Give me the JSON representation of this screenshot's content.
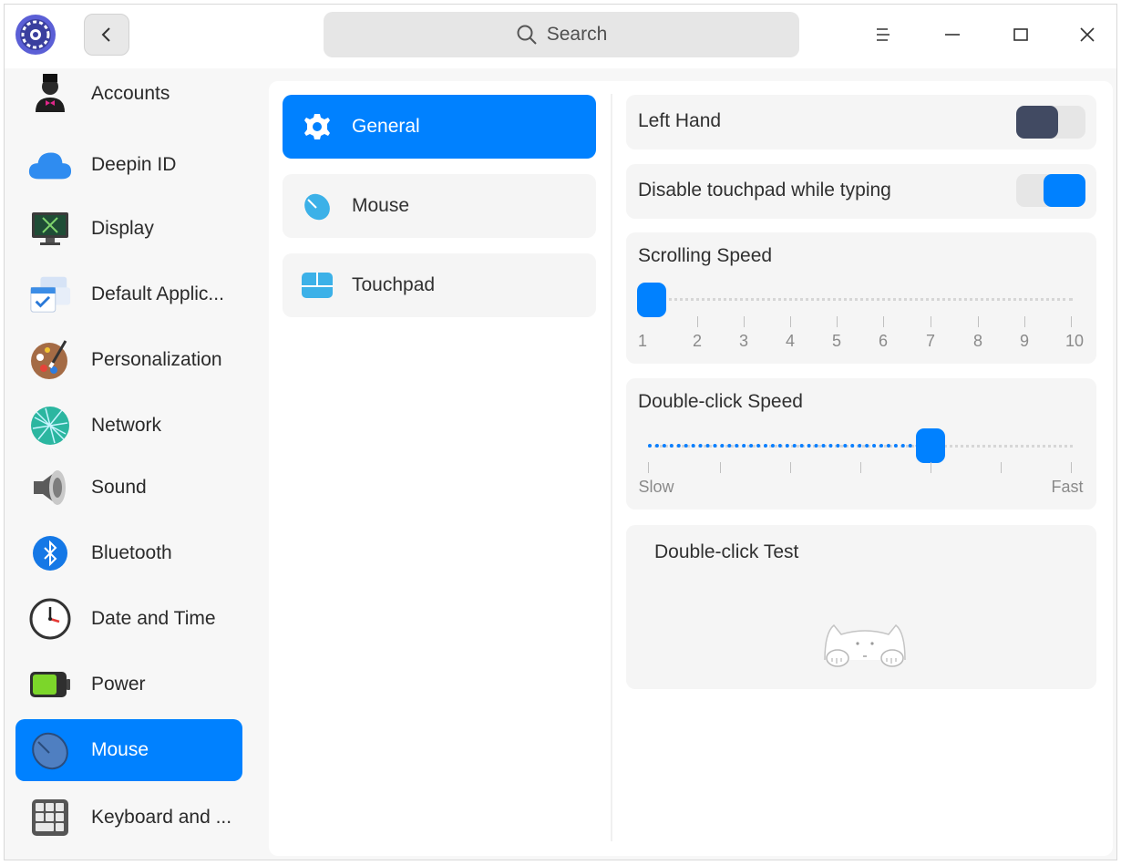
{
  "titlebar": {
    "search_placeholder": "Search",
    "icons": [
      "app-settings-icon",
      "back-arrow-icon",
      "search-icon",
      "menu-icon",
      "minimize-icon",
      "maximize-icon",
      "close-icon"
    ]
  },
  "sidebar": {
    "items": [
      {
        "label": "Accounts",
        "icon": "accounts-icon"
      },
      {
        "label": "Deepin ID",
        "icon": "cloud-icon"
      },
      {
        "label": "Display",
        "icon": "display-icon"
      },
      {
        "label": "Default Applic...",
        "icon": "default-applications-icon"
      },
      {
        "label": "Personalization",
        "icon": "palette-icon"
      },
      {
        "label": "Network",
        "icon": "network-icon"
      },
      {
        "label": "Sound",
        "icon": "speaker-icon"
      },
      {
        "label": "Bluetooth",
        "icon": "bluetooth-icon"
      },
      {
        "label": "Date and Time",
        "icon": "clock-icon"
      },
      {
        "label": "Power",
        "icon": "battery-icon"
      },
      {
        "label": "Mouse",
        "icon": "mouse-icon",
        "active": true
      },
      {
        "label": "Keyboard and ...",
        "icon": "keyboard-icon"
      }
    ]
  },
  "subnav": {
    "items": [
      {
        "label": "General",
        "icon": "gear-icon",
        "active": true
      },
      {
        "label": "Mouse",
        "icon": "mouse-icon"
      },
      {
        "label": "Touchpad",
        "icon": "touchpad-icon"
      }
    ]
  },
  "settings": {
    "left_hand": {
      "label": "Left Hand",
      "enabled": false
    },
    "disable_touchpad": {
      "label": "Disable touchpad while typing",
      "enabled": true
    },
    "scrolling_speed": {
      "label": "Scrolling Speed",
      "value": 1,
      "ticks": [
        "1",
        "2",
        "3",
        "4",
        "5",
        "6",
        "7",
        "8",
        "9",
        "10"
      ]
    },
    "double_click_speed": {
      "label": "Double-click Speed",
      "value_fraction": 0.67,
      "min_label": "Slow",
      "max_label": "Fast"
    },
    "double_click_test": {
      "label": "Double-click Test",
      "icon": "cat-icon"
    }
  },
  "colors": {
    "accent": "#0081ff",
    "toggle_off_knob": "#414a62",
    "card_bg": "#f5f5f5"
  }
}
